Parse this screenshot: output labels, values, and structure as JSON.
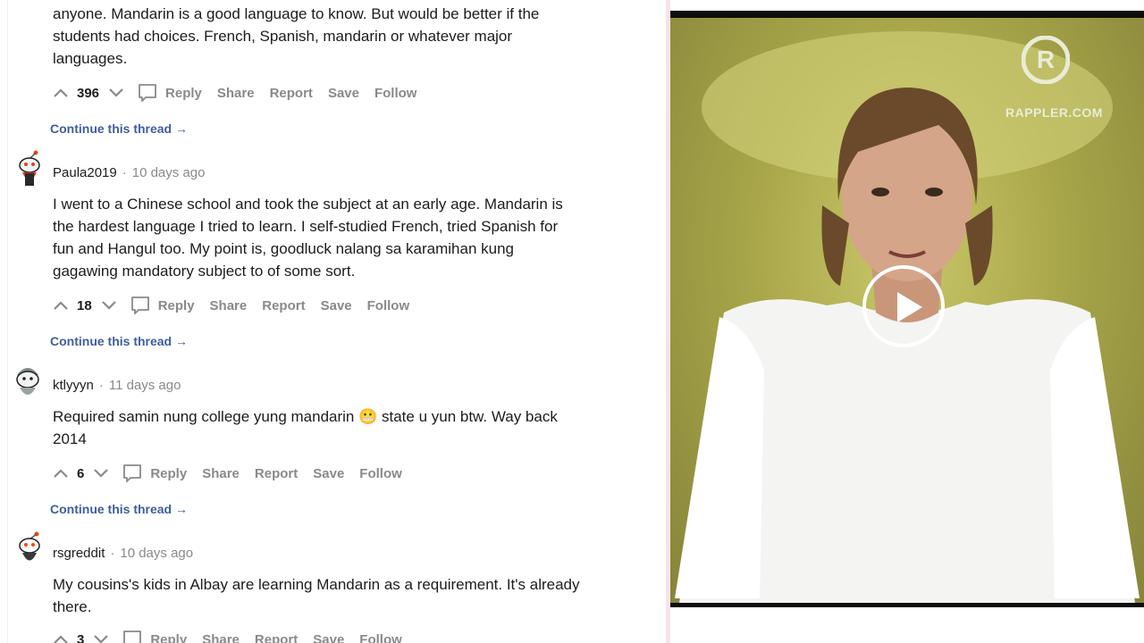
{
  "actions": {
    "reply": "Reply",
    "share": "Share",
    "report": "Report",
    "save": "Save",
    "follow": "Follow",
    "continue": "Continue this thread →"
  },
  "comments": [
    {
      "lines": [
        "anyone. Mandarin is a good language to know. But would be better if the",
        "students had choices. French, Spanish, mandarin or whatever major",
        "languages."
      ],
      "votes": "396"
    },
    {
      "author": "Paula2019",
      "time": "10 days ago",
      "lines": [
        "I went to a Chinese school and took the subject at an early age. Mandarin is",
        "the hardest language I tried to learn. I self-studied French, tried Spanish for",
        "fun and Hangul too. My point is, goodluck nalang sa karamihan kung",
        "gagawing mandatory subject to of some sort."
      ],
      "votes": "18"
    },
    {
      "author": "ktlyyyn",
      "time": "11 days ago",
      "lines": [
        "Required samin nung college yung mandarin 😬 state u yun btw. Way back",
        "2014"
      ],
      "votes": "6"
    },
    {
      "author": "rsgreddit",
      "time": "10 days ago",
      "lines": [
        "My cousins's kids in Albay are learning Mandarin as a requirement. It's already",
        "there."
      ],
      "votes": "3"
    }
  ],
  "video": {
    "watermark": "RAPPLER.COM",
    "logo_letter": "R"
  }
}
